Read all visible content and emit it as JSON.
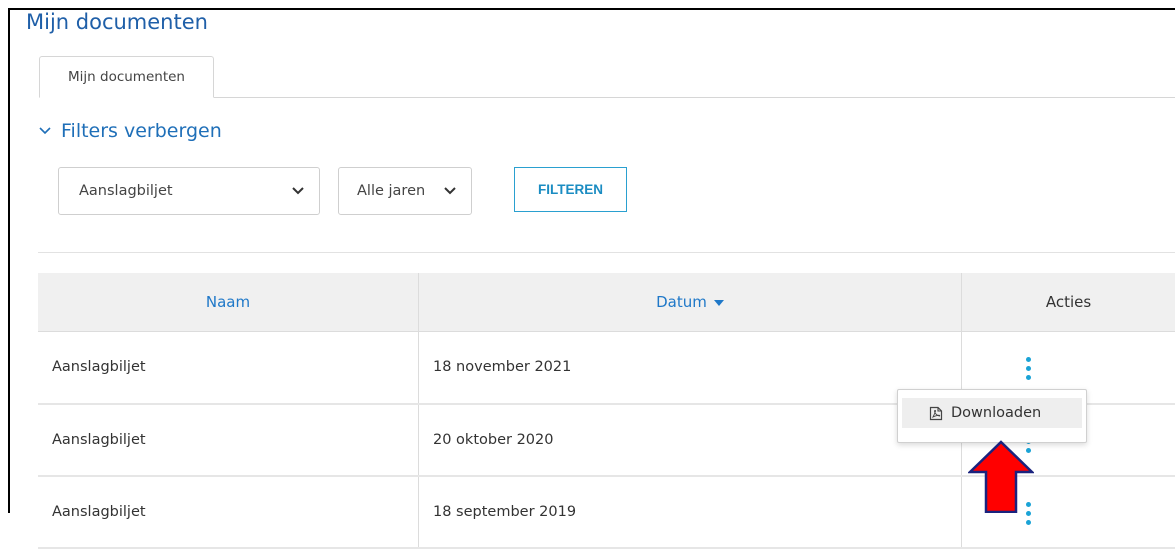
{
  "page": {
    "title": "Mijn documenten"
  },
  "tabs": [
    {
      "label": "Mijn documenten",
      "active": true
    }
  ],
  "filters": {
    "toggle_label": "Filters verbergen",
    "type_select": {
      "value": "Aanslagbiljet"
    },
    "year_select": {
      "value": "Alle jaren"
    },
    "filter_button_label": "FILTEREN"
  },
  "table": {
    "headers": {
      "naam": "Naam",
      "datum": "Datum",
      "acties": "Acties"
    },
    "sorted_by": "Datum",
    "sort_direction": "descending",
    "rows": [
      {
        "naam": "Aanslagbiljet",
        "datum": "18 november 2021"
      },
      {
        "naam": "Aanslagbiljet",
        "datum": "20 oktober 2020"
      },
      {
        "naam": "Aanslagbiljet",
        "datum": "18 september 2019"
      }
    ]
  },
  "context_menu": {
    "items": [
      {
        "label": "Downloaden",
        "icon": "pdf-file-icon"
      }
    ]
  },
  "annotation": {
    "arrow_color": "#ff0000",
    "arrow_outline": "#1a237e"
  },
  "colors": {
    "title": "#1f5fa8",
    "link": "#1f78c8",
    "accent": "#1aa3d6",
    "header_bg": "#f0f0f0"
  }
}
